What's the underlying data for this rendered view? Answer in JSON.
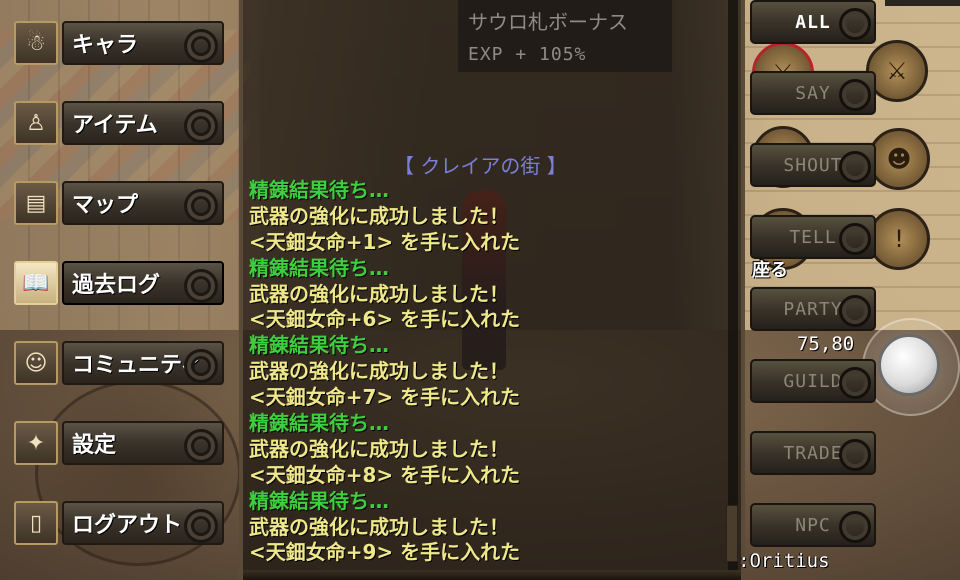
{
  "menu": {
    "items": [
      {
        "label": "キャラ",
        "icon": "☃"
      },
      {
        "label": "アイテム",
        "icon": "♙"
      },
      {
        "label": "マップ",
        "icon": "▤"
      },
      {
        "label": "過去ログ",
        "icon": "📖"
      },
      {
        "label": "コミュニティ",
        "icon": "☺"
      },
      {
        "label": "設定",
        "icon": "✦"
      },
      {
        "label": "ログアウト",
        "icon": "▯"
      }
    ],
    "active": "過去ログ"
  },
  "bonus": {
    "title": "サウロ札ボーナス",
    "exp": "EXP + 105%"
  },
  "log": {
    "area": "【 クレイアの街 】",
    "lines": [
      {
        "text": "精錬結果待ち…",
        "color": "green"
      },
      {
        "text": "武器の強化に成功しました！",
        "color": "yellow"
      },
      {
        "text": "<天鈿女命+1> を手に入れた",
        "color": "yellow"
      },
      {
        "text": "精錬結果待ち…",
        "color": "green"
      },
      {
        "text": "武器の強化に成功しました！",
        "color": "yellow"
      },
      {
        "text": "<天鈿女命+6> を手に入れた",
        "color": "yellow"
      },
      {
        "text": "精錬結果待ち…",
        "color": "green"
      },
      {
        "text": "武器の強化に成功しました！",
        "color": "yellow"
      },
      {
        "text": "<天鈿女命+7> を手に入れた",
        "color": "yellow"
      },
      {
        "text": "精錬結果待ち…",
        "color": "green"
      },
      {
        "text": "武器の強化に成功しました！",
        "color": "yellow"
      },
      {
        "text": "<天鈿女命+8> を手に入れた",
        "color": "yellow"
      },
      {
        "text": "精錬結果待ち…",
        "color": "green"
      },
      {
        "text": "武器の強化に成功しました！",
        "color": "yellow"
      },
      {
        "text": "<天鈿女命+9> を手に入れた",
        "color": "yellow"
      }
    ]
  },
  "filters": {
    "buttons": [
      "ALL",
      "SAY",
      "SHOUT",
      "TELL",
      "PARTY",
      "GUILD",
      "TRADE",
      "NPC"
    ],
    "active": "ALL"
  },
  "hud": {
    "sit_label": "座る",
    "coords": "75,80",
    "player": ":Oritius"
  },
  "colors": {
    "green_text": "#3ecf3e",
    "yellow_text": "#efe88a",
    "area_text": "#7b7fd8"
  }
}
